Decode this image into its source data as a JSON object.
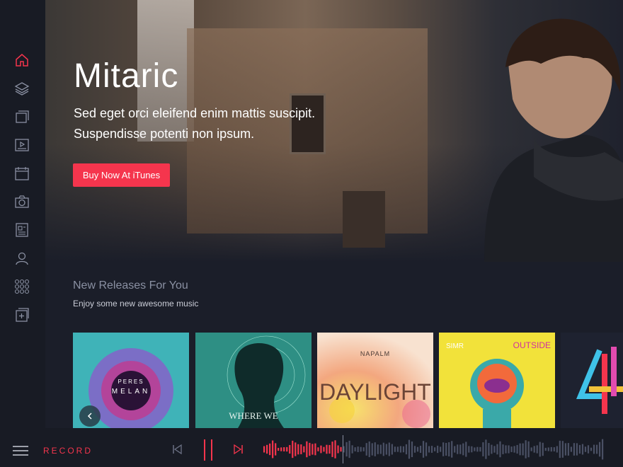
{
  "hero": {
    "title": "Mitaric",
    "subtitle_line1": "Sed eget orci eleifend enim mattis suscipit.",
    "subtitle_line2": "Suspendisse potenti non ipsum.",
    "cta_label": "Buy Now At iTunes"
  },
  "releases": {
    "title": "New Releases For You",
    "subtitle": "Enjoy some new awesome music"
  },
  "albums": [
    {
      "label_top": "PERES",
      "label_main": "MELAN"
    },
    {
      "label_top": "",
      "label_main": "WHERE WE"
    },
    {
      "label_top": "NAPALM",
      "label_main": "DAYLIGHT"
    },
    {
      "label_top": "SIMR",
      "label_main": "OUTSIDE"
    },
    {
      "label_top": "",
      "label_main": "4"
    }
  ],
  "player": {
    "record_label": "RECORD"
  },
  "sidebar": {
    "icons": [
      "home-icon",
      "layers-icon",
      "albums-icon",
      "video-icon",
      "calendar-icon",
      "camera-icon",
      "news-icon",
      "user-icon",
      "grid-icon",
      "add-icon"
    ]
  },
  "colors": {
    "accent": "#f5354d",
    "background": "#1b1e29",
    "sidebar": "#181b24",
    "icon_gray": "#8a90a2"
  }
}
